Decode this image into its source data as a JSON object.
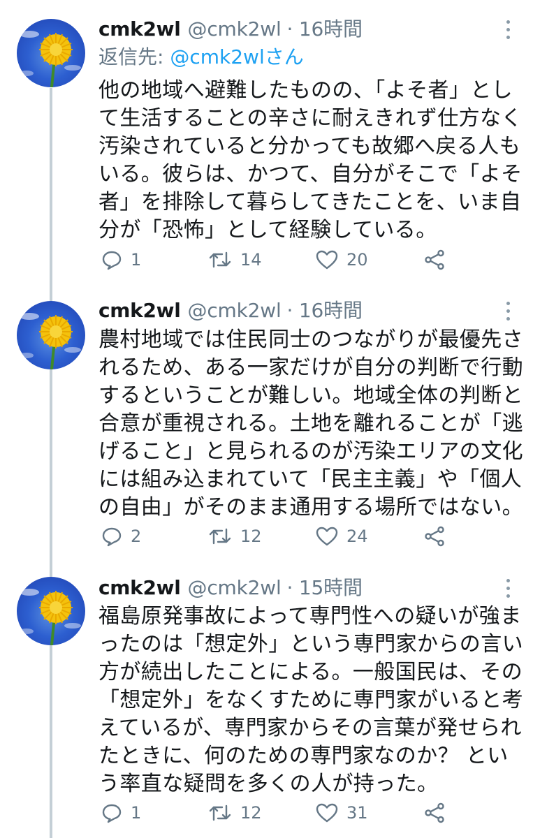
{
  "tweets": [
    {
      "name": "cmk2wl",
      "handle": "@cmk2wl",
      "time": "· 16時間",
      "reply_prefix": "返信先:",
      "reply_handle": "@cmk2wlさん",
      "lines": [
        "他の地域へ避難したものの、「よそ者」とし",
        "て生活することの辛さに耐えきれず仕方なく",
        "汚染されていると分かっても故郷へ戻る人も",
        "いる。彼らは、かつて、自分がそこで「よそ",
        "者」を排除して暮らしてきたことを、いま自",
        "分が「恐怖」として経験している。"
      ],
      "replies": "1",
      "retweets": "14",
      "likes": "20"
    },
    {
      "name": "cmk2wl",
      "handle": "@cmk2wl",
      "time": "· 16時間",
      "lines": [
        "農村地域では住民同士のつながりが最優先さ",
        "れるため、ある一家だけが自分の判断で行動",
        "するということが難しい。地域全体の判断と",
        "合意が重視される。土地を離れることが「逃",
        "げること」と見られるのが汚染エリアの文化",
        "には組み込まれていて「民主主義」や「個人",
        "の自由」がそのまま通用する場所ではない。"
      ],
      "replies": "2",
      "retweets": "12",
      "likes": "24"
    },
    {
      "name": "cmk2wl",
      "handle": "@cmk2wl",
      "time": "· 15時間",
      "lines": [
        "福島原発事故によって専門性への疑いが強ま",
        "ったのは「想定外」という専門家からの言い",
        "方が続出したことによる。一般国民は、その",
        "「想定外」をなくすために専門家がいると考",
        "えているが、専門家からその言葉が発せられ",
        "たときに、何のための専門家なのか？ とい",
        "う率直な疑問を多くの人が持った。"
      ],
      "replies": "1",
      "retweets": "12",
      "likes": "31"
    }
  ],
  "colors": {
    "text": "#14171a",
    "secondary": "#657786",
    "link": "#1da1f2",
    "thread_line": "#c4cfd6"
  }
}
